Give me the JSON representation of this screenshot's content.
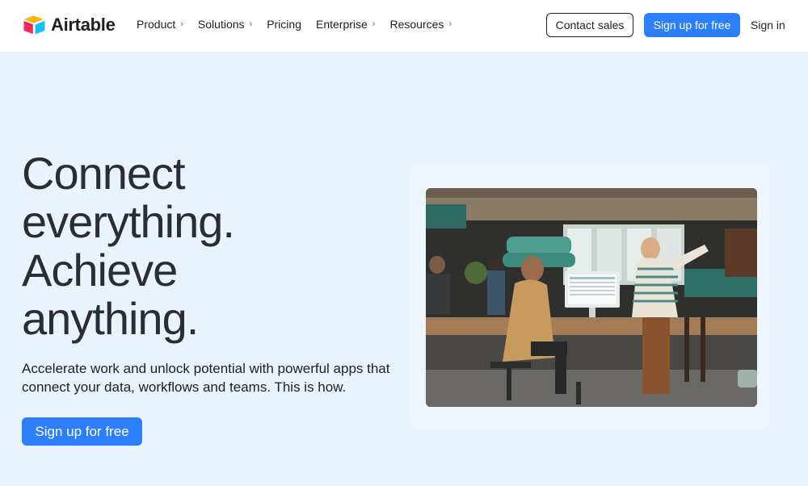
{
  "brand": {
    "name": "Airtable"
  },
  "nav": {
    "links": [
      {
        "label": "Product",
        "has_menu": true
      },
      {
        "label": "Solutions",
        "has_menu": true
      },
      {
        "label": "Pricing",
        "has_menu": false
      },
      {
        "label": "Enterprise",
        "has_menu": true
      },
      {
        "label": "Resources",
        "has_menu": true
      }
    ],
    "contact_sales": "Contact sales",
    "signup": "Sign up for free",
    "signin": "Sign in"
  },
  "hero": {
    "headline_lines": [
      "Connect",
      "everything.",
      "Achieve",
      "anything."
    ],
    "subtext": "Accelerate work and unlock potential with powerful apps that connect your data, workflows and teams. This is how.",
    "cta": "Sign up for free"
  },
  "colors": {
    "accent": "#2d7ff9",
    "hero_background": "#e9f3fd",
    "text": "#1d1f25"
  },
  "icons": {
    "logo": "airtable-logo-icon",
    "chevron": "chevron-right-icon"
  }
}
